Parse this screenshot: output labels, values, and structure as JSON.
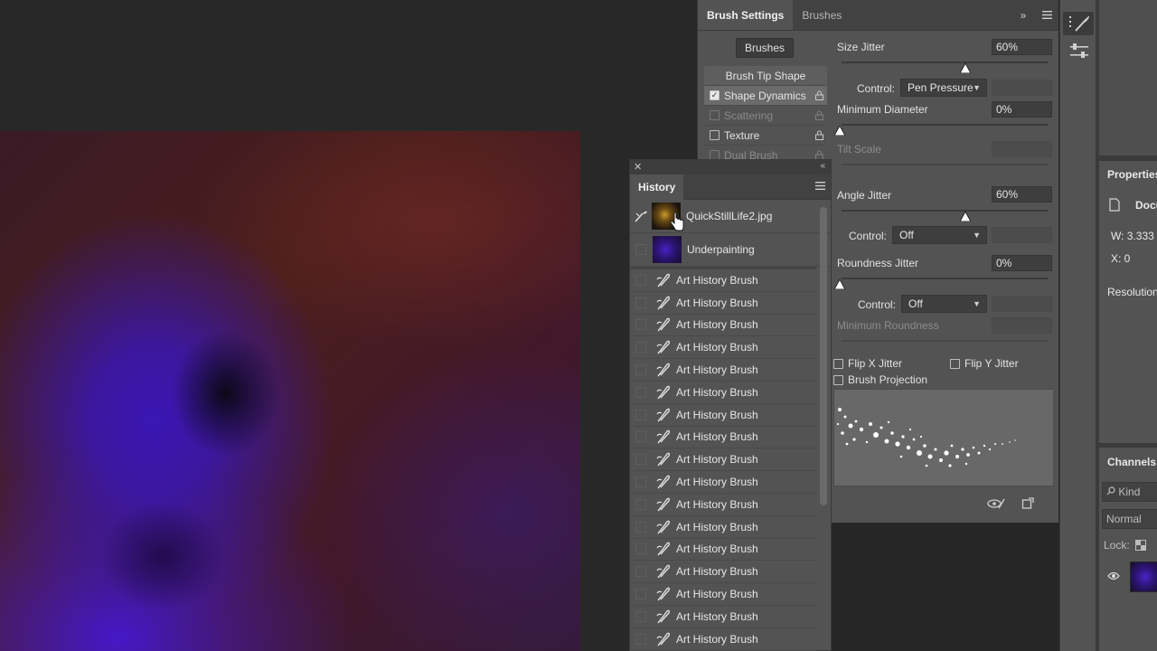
{
  "brush_settings": {
    "tabs": [
      "Brush Settings",
      "Brushes"
    ],
    "brushes_button": "Brushes",
    "tip_list": {
      "header": "Brush Tip Shape",
      "items": [
        {
          "label": "Shape Dynamics",
          "checked": true,
          "selected": true,
          "enabled": true
        },
        {
          "label": "Scattering",
          "checked": false,
          "selected": false,
          "enabled": false
        },
        {
          "label": "Texture",
          "checked": false,
          "selected": false,
          "enabled": true
        },
        {
          "label": "Dual Brush",
          "checked": false,
          "selected": false,
          "enabled": false
        }
      ]
    },
    "size_jitter": {
      "label": "Size Jitter",
      "value": "60%"
    },
    "size_control": {
      "label": "Control:",
      "value": "Pen Pressure"
    },
    "min_diameter": {
      "label": "Minimum Diameter",
      "value": "0%"
    },
    "tilt_scale": {
      "label": "Tilt Scale"
    },
    "angle_jitter": {
      "label": "Angle Jitter",
      "value": "60%"
    },
    "angle_control": {
      "label": "Control:",
      "value": "Off"
    },
    "roundness_jitter": {
      "label": "Roundness Jitter",
      "value": "0%"
    },
    "roundness_control": {
      "label": "Control:",
      "value": "Off"
    },
    "min_roundness": {
      "label": "Minimum Roundness"
    },
    "flip_x": "Flip X Jitter",
    "flip_y": "Flip Y Jitter",
    "brush_projection": "Brush Projection"
  },
  "history": {
    "title": "History",
    "snapshots": [
      "QuickStillLife2.jpg",
      "Underpainting"
    ],
    "states": [
      "Art History Brush",
      "Art History Brush",
      "Art History Brush",
      "Art History Brush",
      "Art History Brush",
      "Art History Brush",
      "Art History Brush",
      "Art History Brush",
      "Art History Brush",
      "Art History Brush",
      "Art History Brush",
      "Art History Brush",
      "Art History Brush",
      "Art History Brush",
      "Art History Brush",
      "Art History Brush",
      "Art History Brush"
    ]
  },
  "properties": {
    "title": "Properties",
    "doc_label": "Docu",
    "width": "W:  3.333",
    "x": "X:  0",
    "resolution": "Resolution"
  },
  "channels": {
    "title": "Channels",
    "kind": "Kind",
    "blend": "Normal",
    "lock": "Lock:"
  },
  "colors": {
    "panel": "#535353",
    "canvas_purple": "#3a16b4",
    "canvas_red": "#4a1e1c"
  },
  "icons": [
    "close-icon",
    "collapse-icon",
    "panel-menu-icon",
    "lock-icon",
    "art-history-brush-icon",
    "cursor-hand-icon",
    "brush-preset-icon",
    "adjust-sliders-icon",
    "eye-icon",
    "toggle-preview-icon",
    "new-preset-icon",
    "search-icon"
  ]
}
